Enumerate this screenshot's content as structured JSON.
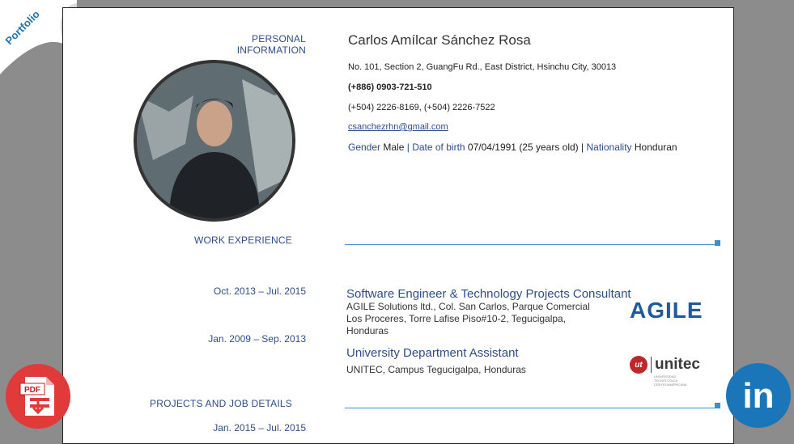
{
  "corner": {
    "label": "Portfolio"
  },
  "sections": {
    "personal": "PERSONAL INFORMATION",
    "work": "WORK EXPERIENCE",
    "projects": "PROJECTS AND JOB DETAILS"
  },
  "personal": {
    "name": "Carlos Amílcar Sánchez Rosa",
    "address": "No. 101, Section 2, GuangFu Rd., East District, Hsinchu City, 30013",
    "phone_primary": "(+886) 0903-721-510",
    "phone_secondary": "(+504) 2226-8169, (+504) 2226-7522",
    "email": "csanchezrhn@gmail.com",
    "gender_label": "Gender",
    "gender_value": "Male",
    "dob_label": "Date of birth",
    "dob_value": "07/04/1991 (25 years old)",
    "nationality_label": "Nationality",
    "nationality_value": "Honduran",
    "separator": "|"
  },
  "work": [
    {
      "date": "Oct. 2013 – Jul. 2015",
      "title": "Software Engineer & Technology Projects Consultant",
      "detail_lines": [
        "AGILE Solutions ltd., Col. San Carlos, Parque Comercial",
        "Los Proceres, Torre Lafise Piso#10-2, Tegucigalpa,",
        "Honduras"
      ],
      "logo": "AGILE"
    },
    {
      "date": "Jan. 2009 – Sep. 2013",
      "title": "University Department Assistant",
      "detail_lines": [
        "UNITEC, Campus Tegucigalpa, Honduras"
      ],
      "logo_mark": "ut",
      "logo": "unitec",
      "logo_sub": "UNIVERSIDAD TECNOLÓGICA CENTROAMERICANA"
    }
  ],
  "projects": [
    {
      "date": "Jan. 2015 – Jul. 2015"
    }
  ],
  "floating": {
    "pdf_label": "PDF",
    "linkedin_label": "in"
  },
  "colors": {
    "accent": "#2e4c8c",
    "rule": "#3a8fd0",
    "pdf": "#e03a3a",
    "linkedin": "#1a76b8"
  }
}
